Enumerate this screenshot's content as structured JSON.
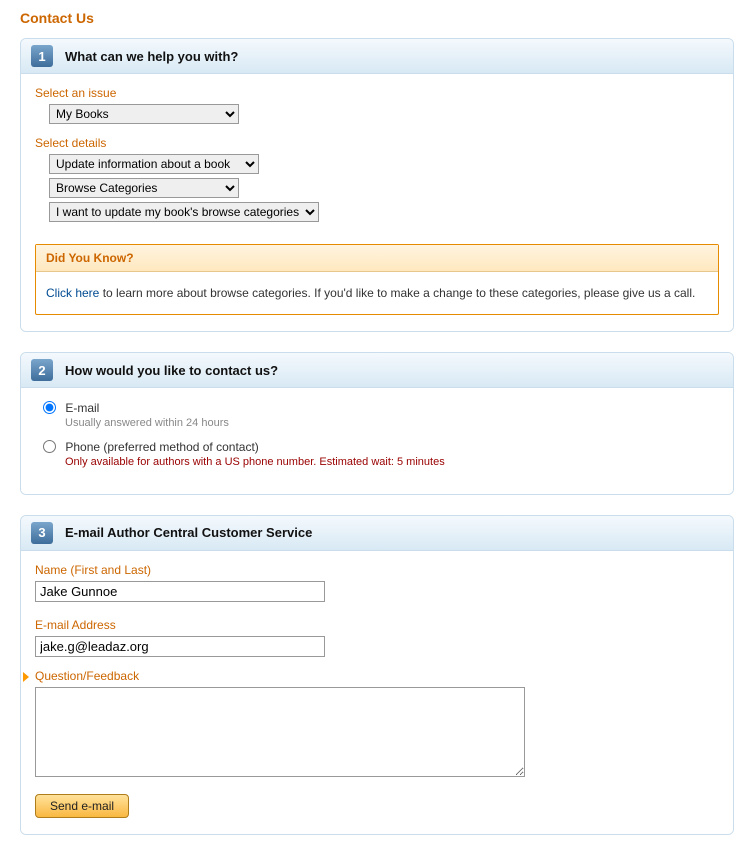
{
  "page_title": "Contact Us",
  "step1": {
    "num": "1",
    "title": "What can we help you with?",
    "issue_label": "Select an issue",
    "issue_value": "My Books",
    "details_label": "Select details",
    "details1_value": "Update information about a book",
    "details2_value": "Browse Categories",
    "details3_value": "I want to update my book's browse categories",
    "info_head": "Did You Know?",
    "info_link": "Click here",
    "info_text": " to learn more about browse categories. If you'd like to make a change to these categories, please give us a call."
  },
  "step2": {
    "num": "2",
    "title": "How would you like to contact us?",
    "email_label": "E-mail",
    "email_sub": "Usually answered within 24 hours",
    "phone_label": "Phone (preferred method of contact)",
    "phone_sub": "Only available for authors with a US phone number. Estimated wait: 5 minutes"
  },
  "step3": {
    "num": "3",
    "title": "E-mail Author Central Customer Service",
    "name_label": "Name (First and Last)",
    "name_value": "Jake Gunnoe",
    "email_label": "E-mail Address",
    "email_value": "jake.g@leadaz.org",
    "question_label": "Question/Feedback",
    "question_value": "",
    "send_label": "Send e-mail"
  }
}
